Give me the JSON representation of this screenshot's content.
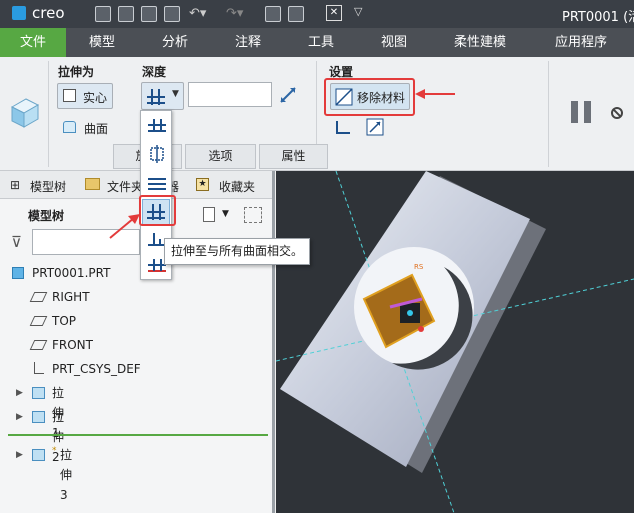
{
  "app": {
    "logo": "creo",
    "window_title": "PRT0001 (活"
  },
  "menu": [
    "文件",
    "模型",
    "分析",
    "注释",
    "工具",
    "视图",
    "柔性建模",
    "应用程序"
  ],
  "ribbon": {
    "extrude_as_label": "拉伸为",
    "solid_label": "实心",
    "surface_label": "曲面",
    "depth_label": "深度",
    "depth_value": "",
    "settings_label": "设置",
    "remove_material_label": "移除材料",
    "tabs": [
      "放置",
      "选项",
      "属性"
    ]
  },
  "depth_menu": {
    "tooltip": "拉伸至与所有曲面相交。",
    "options": [
      "blind-icon",
      "symmetric-icon",
      "to-next-icon",
      "through-all-icon",
      "through-until-icon",
      "to-selected-icon"
    ]
  },
  "left_panel": {
    "tabs": [
      "模型树",
      "文件夹浏览器",
      "收藏夹"
    ],
    "tree_label": "模型树",
    "filter_value": "",
    "items": [
      {
        "label": "PRT0001.PRT",
        "icon": "part-icon"
      },
      {
        "label": "RIGHT",
        "icon": "datum-plane-icon"
      },
      {
        "label": "TOP",
        "icon": "datum-plane-icon"
      },
      {
        "label": "FRONT",
        "icon": "datum-plane-icon"
      },
      {
        "label": "PRT_CSYS_DEF",
        "icon": "csys-icon"
      },
      {
        "label": "拉伸 1",
        "icon": "extrude-icon"
      },
      {
        "label": "拉伸 2",
        "icon": "extrude-icon"
      },
      {
        "label": "拉伸 3",
        "icon": "extrude-icon"
      }
    ]
  },
  "colors": {
    "accent_green": "#57a843",
    "highlight_red": "#e33b3b",
    "viewport_bg": "#2f3338"
  }
}
